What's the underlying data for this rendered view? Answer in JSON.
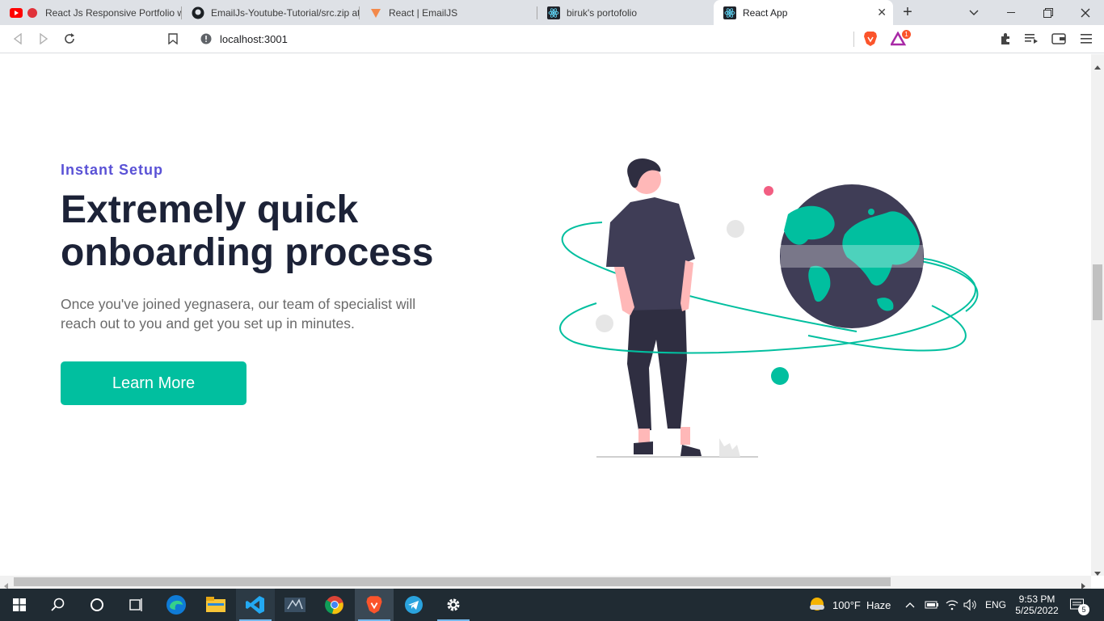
{
  "browser": {
    "tabs": [
      {
        "title": "React Js Responsive Portfolio w",
        "favicon": "youtube-icon"
      },
      {
        "title": "EmailJs-Youtube-Tutorial/src.zip at",
        "favicon": "github-icon"
      },
      {
        "title": "React | EmailJS",
        "favicon": "emailjs-icon"
      },
      {
        "title": "biruk's portofolio",
        "favicon": "react-icon"
      },
      {
        "title": "React App",
        "favicon": "react-icon",
        "active": true
      }
    ],
    "url": "localhost:3001",
    "brave_badge_count": "1"
  },
  "page": {
    "eyebrow": "Instant Setup",
    "headline": "Extremely quick onboarding process",
    "description": "Once you've joined yegnasera, our team of specialist will reach out to you and get you set up in minutes.",
    "cta_label": "Learn More"
  },
  "taskbar": {
    "weather": "100°F  Haze",
    "language": "ENG",
    "time": "9:53 PM",
    "date": "5/25/2022",
    "notification_count": "5"
  },
  "colors": {
    "accent": "#01bf9f",
    "eyebrow": "#5a52d6",
    "headline": "#1c2237",
    "dark_figure": "#3f3d56",
    "pink": "#f25e82"
  }
}
